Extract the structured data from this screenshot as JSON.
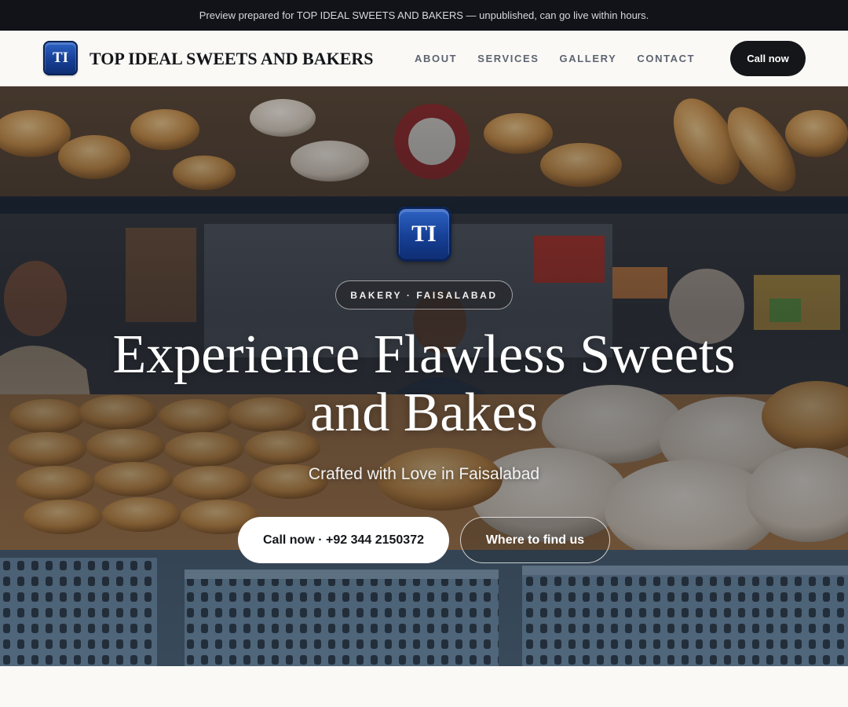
{
  "preview_bar": {
    "text": "Preview prepared for TOP IDEAL SWEETS AND BAKERS — unpublished, can go live within hours."
  },
  "header": {
    "logo_initials": "TI",
    "brand_name": "TOP IDEAL SWEETS AND BAKERS",
    "nav": [
      {
        "label": "ABOUT"
      },
      {
        "label": "SERVICES"
      },
      {
        "label": "GALLERY"
      },
      {
        "label": "CONTACT"
      }
    ],
    "cta_label": "Call now"
  },
  "hero": {
    "logo_initials": "TI",
    "tag": "BAKERY · FAISALABAD",
    "title": "Experience Flawless Sweets and Bakes",
    "subtitle": "Crafted with Love in Faisalabad",
    "primary_button": "Call now · +92 344 2150372",
    "secondary_button": "Where to find us",
    "background_image": "bakery stall with bread loaves, crates and vendors"
  },
  "colors": {
    "preview_bar_bg": "#111318",
    "dark": "#14161a",
    "logo_blue": "#163f95",
    "nav_text": "#5d6470",
    "page_bg": "#faf9f6"
  }
}
